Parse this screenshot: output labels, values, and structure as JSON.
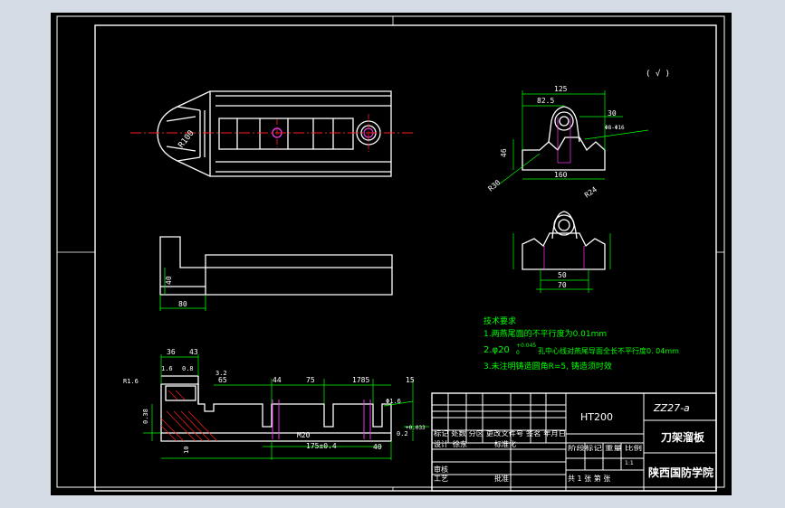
{
  "drawing": {
    "notes": {
      "heading": "技术要求",
      "line1": "1.两燕尾面的不平行度为0.01mm",
      "line2a": "2.φ20",
      "line2_tol_upper": "+0.045",
      "line2_tol_lower": "0",
      "line2b": "孔中心线对燕尾导面全长不平行度0. 04mm",
      "line3": "3.未注明铸造圆角R=5, 铸造须时效"
    },
    "roughness_symbol": "( √ )",
    "dims_top_view": {
      "radius": "R100"
    },
    "dims_side_view": {
      "d1": "40",
      "d2": "80"
    },
    "dims_section_upper": {
      "d1": "125",
      "d2": "82.5",
      "d3": "30",
      "d4": "46",
      "d5": "R30",
      "d6": "R24",
      "d7": "160",
      "d8": "Φ8-Φ16"
    },
    "dims_section_lower": {
      "d1": "50",
      "d2": "70"
    },
    "dims_bottom_view": {
      "d1": "36",
      "d2": "43",
      "d3": "1.6",
      "d4": "0.8",
      "d5": "R1.6",
      "d6": "3.2",
      "d7": "65",
      "d8": "44",
      "d9": "75",
      "d10": "1785",
      "d11": "15",
      "d12": "Φ1.6",
      "d13": "0.38",
      "d14": "10",
      "d15": "M20",
      "d16": "175±0.4",
      "d17": "40",
      "d18": "0.2",
      "d19": "+0.033"
    },
    "title_block": {
      "material": "HT200",
      "drawing_no": "ZZ27-a",
      "part_name": "刀架溜板",
      "school": "陕西国防学院",
      "hdr_left": "标记 处数 分区 更改文件号 签名 年月日",
      "row_design": "设计",
      "designer": "徐东",
      "standardize": "标准化",
      "row_review": "审核",
      "row_process": "工艺",
      "approve": "批准",
      "stage_hdr": "阶段标记 重量 比例",
      "scale": "1:1",
      "sheets": "共 1 张 第 张"
    }
  }
}
